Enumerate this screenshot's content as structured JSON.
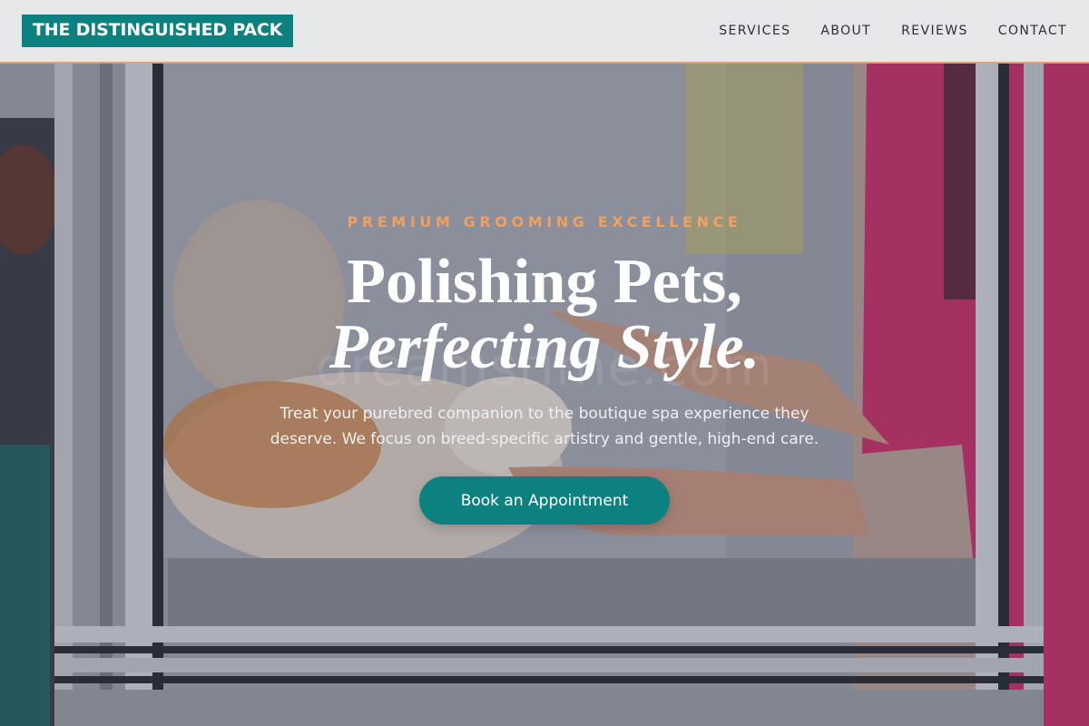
{
  "header": {
    "logo": "THE DISTINGUISHED PACK",
    "nav": [
      {
        "label": "SERVICES"
      },
      {
        "label": "ABOUT"
      },
      {
        "label": "REVIEWS"
      },
      {
        "label": "CONTACT"
      }
    ]
  },
  "hero": {
    "eyebrow": "PREMIUM GROOMING EXCELLENCE",
    "headline_line1": "Polishing Pets,",
    "headline_line2": "Perfecting Style.",
    "subtext": "Treat your purebred companion to the boutique spa experience they deserve. We focus on breed-specific artistry and gentle, high-end care.",
    "cta_label": "Book an Appointment",
    "image_watermark": "dreamstime.com"
  },
  "colors": {
    "brand_teal": "#0b8280",
    "accent_orange": "#f0a060",
    "header_border": "#e8a066"
  }
}
